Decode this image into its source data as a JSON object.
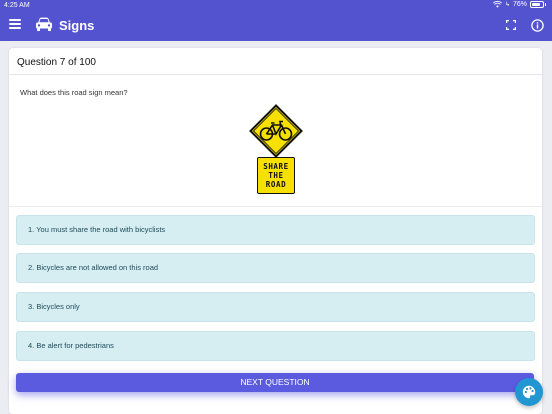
{
  "status_bar": {
    "time": "4:25 AM",
    "battery": "76%"
  },
  "app_bar": {
    "title": "Signs",
    "background_color": "#5453cf",
    "icons": [
      "menu-icon",
      "car-icon",
      "fullscreen-icon",
      "info-icon"
    ]
  },
  "quiz": {
    "counter": "Question 7 of 100",
    "prompt": "What does this road sign mean?",
    "sign": {
      "plaque_lines": [
        "SHARE",
        "THE",
        "ROAD"
      ],
      "diamond_icon": "bicycle-icon",
      "sign_color": "#f5e000"
    },
    "answers": [
      "1. You must share the road with bicyclists",
      "2. Bicycles are not allowed on this road",
      "3. Bicycles only",
      "4. Be alert for pedestrians"
    ]
  },
  "next_button": {
    "label": "NEXT QUESTION",
    "color": "#5b5be0"
  },
  "fab": {
    "icon": "palette-icon",
    "color": "#2196d3"
  }
}
